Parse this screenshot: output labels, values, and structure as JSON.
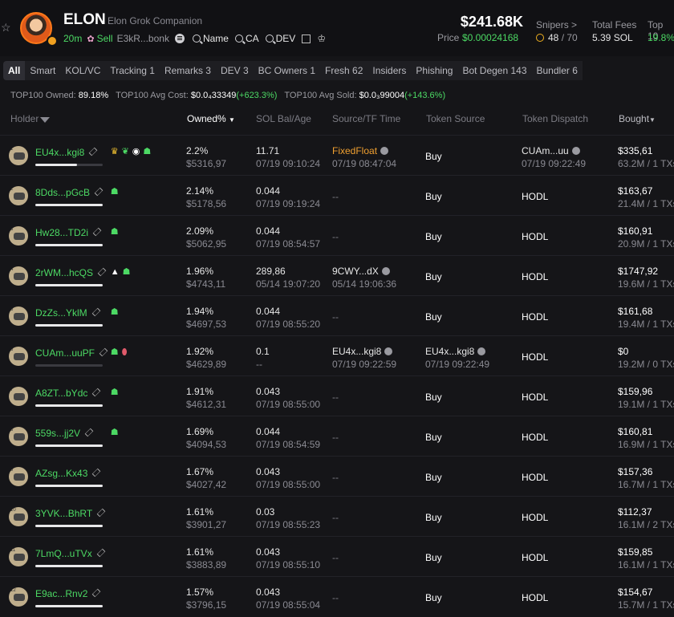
{
  "header": {
    "token_name": "ELON",
    "token_full": "Elon Grok Companion",
    "age": "20m",
    "sell_label": "Sell",
    "address": "E3kR...bonk",
    "search_name": "Name",
    "search_ca": "CA",
    "dev_label": "DEV",
    "market_cap": "$241.68K",
    "price_label": "Price",
    "price_value": "$0.00024168",
    "snipers_label": "Snipers >",
    "snipers_value": "48",
    "snipers_total": "/ 70",
    "fees_label": "Total Fees",
    "fees_value": "5.39 SOL",
    "top10_label": "Top 10",
    "top10_value": "19.8%"
  },
  "tabs": [
    {
      "label": "All"
    },
    {
      "label": "Smart"
    },
    {
      "label": "KOL/VC"
    },
    {
      "label": "Tracking 1"
    },
    {
      "label": "Remarks 3"
    },
    {
      "label": "DEV 3"
    },
    {
      "label": "BC Owners 1"
    },
    {
      "label": "Fresh 62"
    },
    {
      "label": "Insiders"
    },
    {
      "label": "Phishing"
    },
    {
      "label": "Bot Degen 143"
    },
    {
      "label": "Bundler 6"
    }
  ],
  "stats": {
    "owned_label": "TOP100 Owned:",
    "owned_value": "89.18%",
    "avg_cost_label": "TOP100 Avg Cost:",
    "avg_cost_value": "$0.0₄33349",
    "avg_cost_pct": "(+623.3%)",
    "avg_sold_label": "TOP100 Avg Sold:",
    "avg_sold_value": "$0.0₃99004",
    "avg_sold_pct": "(+143.6%)"
  },
  "columns": {
    "holder": "Holder",
    "owned": "Owned%",
    "sol": "SOL Bal/Age",
    "source": "Source/TF Time",
    "token_source": "Token Source",
    "dispatch": "Token Dispatch",
    "bought": "Bought"
  },
  "rows": [
    {
      "num": "1",
      "name": "EU4x...kgi8",
      "owned": "2.2%",
      "owned_usd": "$5316,97",
      "bar": 0.62,
      "sol": "11.71",
      "age": "07/19 09:10:24",
      "src": "FixedFloat",
      "src_time": "07/19 08:47:04",
      "tsrc": "Buy",
      "tsrc_time": "",
      "disp": "CUAm...uu",
      "disp_time": "07/19 09:22:49",
      "bought": "$335,61",
      "bought2": "63.2M / 1 TXs",
      "tags": "gold-crown,sprout,target,person"
    },
    {
      "num": "2",
      "name": "8Dds...pGcB",
      "owned": "2.14%",
      "owned_usd": "$5178,56",
      "bar": 1.0,
      "sol": "0.044",
      "age": "07/19 09:19:24",
      "src": "--",
      "src_time": "",
      "tsrc": "Buy",
      "tsrc_time": "",
      "disp": "HODL",
      "disp_time": "",
      "bought": "$163,67",
      "bought2": "21.4M / 1 TXs",
      "tags": "person"
    },
    {
      "num": "3",
      "name": "Hw28...TD2i",
      "owned": "2.09%",
      "owned_usd": "$5062,95",
      "bar": 1.0,
      "sol": "0.044",
      "age": "07/19 08:54:57",
      "src": "--",
      "src_time": "",
      "tsrc": "Buy",
      "tsrc_time": "",
      "disp": "HODL",
      "disp_time": "",
      "bought": "$160,91",
      "bought2": "20.9M / 1 TXs",
      "tags": "person"
    },
    {
      "num": "4",
      "name": "2rWM...hcQS",
      "owned": "1.96%",
      "owned_usd": "$4743,11",
      "bar": 1.0,
      "sol": "289,86",
      "age": "05/14 19:07:20",
      "src": "9CWY...dX",
      "src_time": "05/14 19:06:36",
      "tsrc": "Buy",
      "tsrc_time": "",
      "disp": "HODL",
      "disp_time": "",
      "bought": "$1747,92",
      "bought2": "19.6M / 1 TXs",
      "tags": "triangle,person"
    },
    {
      "num": "5",
      "name": "DzZs...YklM",
      "owned": "1.94%",
      "owned_usd": "$4697,53",
      "bar": 1.0,
      "sol": "0.044",
      "age": "07/19 08:55:20",
      "src": "--",
      "src_time": "",
      "tsrc": "Buy",
      "tsrc_time": "",
      "disp": "HODL",
      "disp_time": "",
      "bought": "$161,68",
      "bought2": "19.4M / 1 TXs",
      "tags": "person"
    },
    {
      "num": "6",
      "name": "CUAm...uuPF",
      "owned": "1.92%",
      "owned_usd": "$4629,89",
      "bar": 0.0,
      "sol": "0.1",
      "age": "--",
      "src": "EU4x...kgi8",
      "src_time": "07/19 09:22:59",
      "tsrc": "EU4x...kgi8",
      "tsrc_time": "07/19 09:22:49",
      "disp": "HODL",
      "disp_time": "",
      "bought": "$0",
      "bought2": "19.2M / 0 TXs",
      "tags": "person,pill"
    },
    {
      "num": "7",
      "name": "A8ZT...bYdc",
      "owned": "1.91%",
      "owned_usd": "$4612,31",
      "bar": 1.0,
      "sol": "0.043",
      "age": "07/19 08:55:00",
      "src": "--",
      "src_time": "",
      "tsrc": "Buy",
      "tsrc_time": "",
      "disp": "HODL",
      "disp_time": "",
      "bought": "$159,96",
      "bought2": "19.1M / 1 TXs",
      "tags": "person"
    },
    {
      "num": "8",
      "name": "559s...jj2V",
      "owned": "1.69%",
      "owned_usd": "$4094,53",
      "bar": 1.0,
      "sol": "0.044",
      "age": "07/19 08:54:59",
      "src": "--",
      "src_time": "",
      "tsrc": "Buy",
      "tsrc_time": "",
      "disp": "HODL",
      "disp_time": "",
      "bought": "$160,81",
      "bought2": "16.9M / 1 TXs",
      "tags": "person"
    },
    {
      "num": "9",
      "name": "AZsg...Kx43",
      "owned": "1.67%",
      "owned_usd": "$4027,42",
      "bar": 1.0,
      "sol": "0.043",
      "age": "07/19 08:55:00",
      "src": "--",
      "src_time": "",
      "tsrc": "Buy",
      "tsrc_time": "",
      "disp": "HODL",
      "disp_time": "",
      "bought": "$157,36",
      "bought2": "16.7M / 1 TXs",
      "tags": ""
    },
    {
      "num": "10",
      "name": "3YVK...BhRT",
      "owned": "1.61%",
      "owned_usd": "$3901,27",
      "bar": 1.0,
      "sol": "0.03",
      "age": "07/19 08:55:23",
      "src": "--",
      "src_time": "",
      "tsrc": "Buy",
      "tsrc_time": "",
      "disp": "HODL",
      "disp_time": "",
      "bought": "$112,37",
      "bought2": "16.1M / 2 TXs",
      "tags": ""
    },
    {
      "num": "11",
      "name": "7LmQ...uTVx",
      "owned": "1.61%",
      "owned_usd": "$3883,89",
      "bar": 1.0,
      "sol": "0.043",
      "age": "07/19 08:55:10",
      "src": "--",
      "src_time": "",
      "tsrc": "Buy",
      "tsrc_time": "",
      "disp": "HODL",
      "disp_time": "",
      "bought": "$159,85",
      "bought2": "16.1M / 1 TXs",
      "tags": ""
    },
    {
      "num": "12",
      "name": "E9ac...Rnv2",
      "owned": "1.57%",
      "owned_usd": "$3796,15",
      "bar": 1.0,
      "sol": "0.043",
      "age": "07/19 08:55:04",
      "src": "--",
      "src_time": "",
      "tsrc": "Buy",
      "tsrc_time": "",
      "disp": "HODL",
      "disp_time": "",
      "bought": "$154,67",
      "bought2": "15.7M / 1 TXs",
      "tags": ""
    }
  ]
}
